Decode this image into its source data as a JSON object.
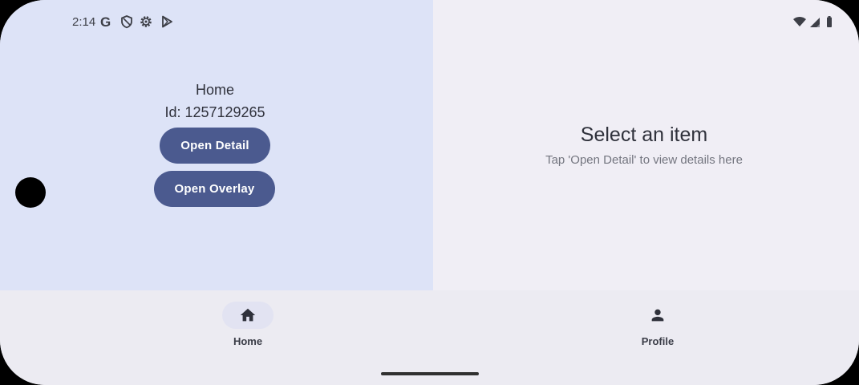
{
  "status_bar": {
    "time": "2:14",
    "left_icons": [
      "google-g-icon",
      "shield-icon",
      "settings-gear-icon",
      "play-store-icon"
    ],
    "right_icons": [
      "wifi-icon",
      "signal-icon",
      "battery-icon"
    ]
  },
  "home": {
    "title": "Home",
    "id_text": "Id: 1257129265",
    "open_detail_label": "Open Detail",
    "open_overlay_label": "Open Overlay"
  },
  "detail": {
    "title": "Select an item",
    "subtitle": "Tap 'Open Detail' to view details here"
  },
  "bottom_nav": {
    "items": [
      {
        "label": "Home",
        "icon": "home-icon",
        "selected": true
      },
      {
        "label": "Profile",
        "icon": "person-icon",
        "selected": false
      }
    ]
  },
  "colors": {
    "left_pane_bg": "#dde3f7",
    "right_pane_bg": "#f0eef5",
    "button_bg": "#4b5a8f",
    "nav_bg": "#ecebf2"
  }
}
